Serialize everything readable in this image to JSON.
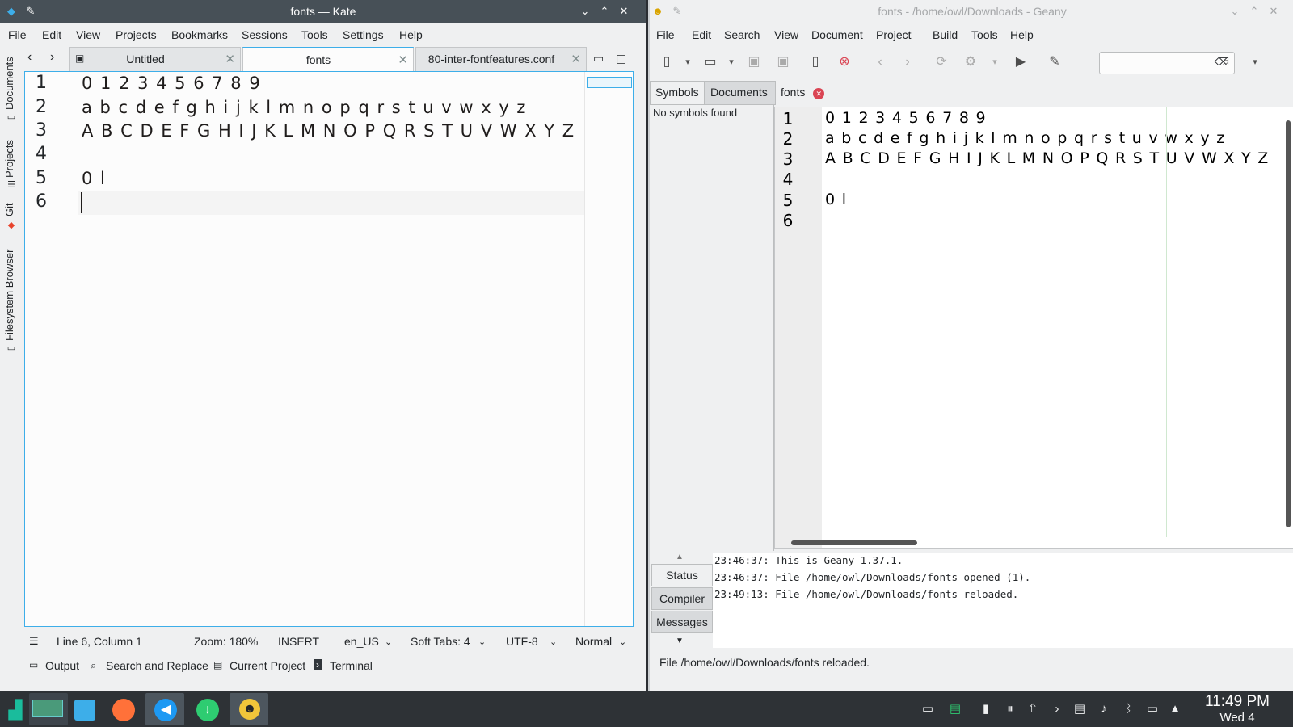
{
  "kate": {
    "title": "fonts — Kate",
    "menu": [
      "File",
      "Edit",
      "View",
      "Projects",
      "Bookmarks",
      "Sessions",
      "Tools",
      "Settings",
      "Help"
    ],
    "side_tabs": [
      "Documents",
      "Projects",
      "Git",
      "Filesystem Browser"
    ],
    "tabs": [
      {
        "label": "Untitled",
        "active": false
      },
      {
        "label": "fonts",
        "active": true
      },
      {
        "label": "80-inter-fontfeatures.conf",
        "active": false
      }
    ],
    "lines": [
      {
        "num": "1",
        "text": "0 1 2 3 4 5 6 7 8 9"
      },
      {
        "num": "2",
        "text": "a b c d e f g h i j k l m n o p q r s t u v w x y z"
      },
      {
        "num": "3",
        "text": "A B C D E F G H I J K L M N O P Q R S T U V W X Y Z"
      },
      {
        "num": "4",
        "text": ""
      },
      {
        "num": "5",
        "text": "0 l"
      },
      {
        "num": "6",
        "text": ""
      }
    ],
    "status": {
      "position": "Line 6, Column 1",
      "zoom": "Zoom: 180%",
      "mode": "INSERT",
      "language": "en_US",
      "tabs": "Soft Tabs: 4",
      "encoding": "UTF-8",
      "input_mode": "Normal"
    },
    "bottom_tools": [
      "Output",
      "Search and Replace",
      "Current Project",
      "Terminal"
    ]
  },
  "geany": {
    "title": "fonts - /home/owl/Downloads - Geany",
    "menu": [
      "File",
      "Edit",
      "Search",
      "View",
      "Document",
      "Project",
      "Build",
      "Tools",
      "Help"
    ],
    "side_tabs": [
      "Symbols",
      "Documents"
    ],
    "no_symbols": "No symbols found",
    "doc_tab": "fonts",
    "lines": [
      {
        "num": "1",
        "text": "0 1 2 3 4 5 6 7 8 9"
      },
      {
        "num": "2",
        "text": "a b c d e f g h i j k l m n o p q r s t u v w x y z"
      },
      {
        "num": "3",
        "text": "A B C D E F G H I J K L M N O P Q R S T U V W X Y Z"
      },
      {
        "num": "4",
        "text": ""
      },
      {
        "num": "5",
        "text": "0 l"
      },
      {
        "num": "6",
        "text": ""
      }
    ],
    "message_tabs": [
      "Status",
      "Compiler",
      "Messages"
    ],
    "messages": [
      "23:46:37: This is Geany 1.37.1.",
      "23:46:37: File /home/owl/Downloads/fonts opened (1).",
      "23:49:13: File /home/owl/Downloads/fonts reloaded."
    ],
    "statusbar": "File /home/owl/Downloads/fonts reloaded."
  },
  "taskbar": {
    "clock_time": "11:49 PM",
    "clock_date": "Wed 4"
  },
  "colors": {
    "accent": "#3daee9",
    "kate_titlebar": "#475057",
    "taskbar": "#2e3236"
  }
}
